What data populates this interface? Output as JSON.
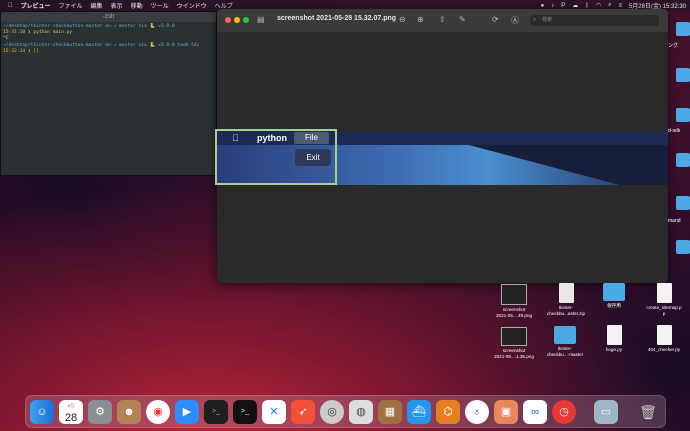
{
  "menubar": {
    "items": [
      "プレビュー",
      "ファイル",
      "編集",
      "表示",
      "移動",
      "ツール",
      "ウインドウ",
      "ヘルプ"
    ],
    "datetime": "5月28日(金)  15:32:30"
  },
  "terminal": {
    "title": "-zsh",
    "lines": [
      "~/desktop/tkinter-checkbutton-master on ↗ master via 🐍 v3.9.0",
      "15:31:10 ❯ python main.py",
      "^C",
      "~/desktop/tkinter-checkbutton-master on ↗ master via 🐍 v3.9.0 took 54s",
      "15:32:14 ❯ []"
    ]
  },
  "preview": {
    "title": "screenshot 2021-05-28 15.32.07.png",
    "search_placeholder": "検索",
    "app_menu": "python",
    "file_menu": "File",
    "exit_item": "Exit"
  },
  "desktop": {
    "side_labels": [
      "ング",
      "d-sdk",
      "mand"
    ],
    "icons": [
      {
        "label": "screenshot\n2021-05....49.png",
        "kind": "image"
      },
      {
        "label": "tkinter-\ncheckbu...aster.zip",
        "kind": "zip"
      },
      {
        "label": "保存用",
        "kind": "folder"
      },
      {
        "label": "create_sitemap.p\np",
        "kind": "php"
      },
      {
        "label": "screenshot\n2021-05....1.35.png",
        "kind": "image"
      },
      {
        "label": "tkinter-\ncheckbu...-master",
        "kind": "folder"
      },
      {
        "label": "hoge.py",
        "kind": "python"
      },
      {
        "label": "404_checker.py",
        "kind": "python"
      }
    ]
  },
  "dock": {
    "calendar_month": "5月",
    "calendar_day": "28",
    "apps": [
      "finder",
      "calendar",
      "system-preferences",
      "contacts",
      "chrome",
      "zoom",
      "terminal",
      "terminal2",
      "vscode",
      "swift",
      "quicktime",
      "disk-utility",
      "archive",
      "docker",
      "network",
      "sourcetree",
      "ai",
      "preview",
      "infinity",
      "clock",
      "screenshot",
      "trash"
    ]
  }
}
